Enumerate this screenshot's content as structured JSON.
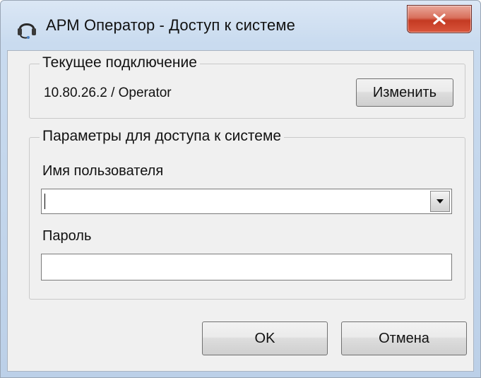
{
  "window": {
    "title": "АРМ Оператор - Доступ к системе",
    "title_icon": "headset-icon",
    "close_icon": "close-x-icon"
  },
  "connection_group": {
    "legend": "Текущее подключение",
    "value": "10.80.26.2 / Operator",
    "change_label": "Изменить"
  },
  "access_group": {
    "legend": "Параметры для доступа к системе",
    "username_label": "Имя пользователя",
    "username_value": "",
    "password_label": "Пароль",
    "password_value": ""
  },
  "buttons": {
    "ok_label": "OK",
    "cancel_label": "Отмена"
  },
  "colors": {
    "close_button": "#c43a22",
    "dialog_background": "#f0f0f0",
    "frame": "#c9dbef"
  }
}
